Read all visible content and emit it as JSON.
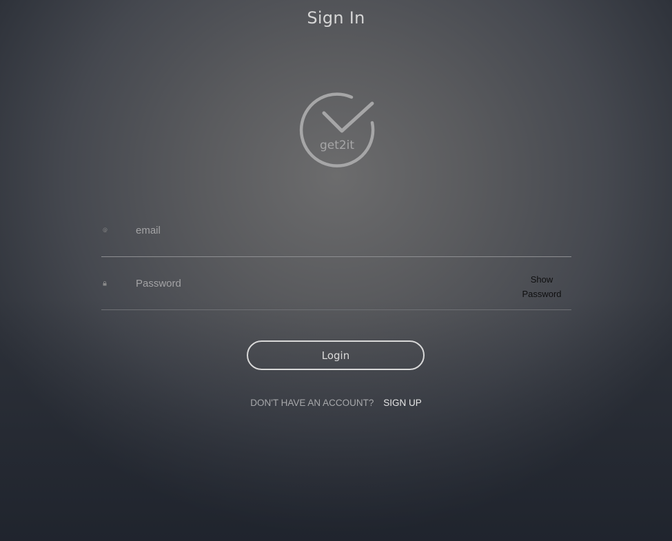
{
  "page": {
    "title": "Sign In"
  },
  "logo": {
    "text": "get2it",
    "icon": "checkmark-circle-icon",
    "color": "#a9a9aa"
  },
  "form": {
    "email": {
      "placeholder": "email",
      "value": "",
      "icon": "at-sign-icon"
    },
    "password": {
      "placeholder": "Password",
      "value": "",
      "icon": "lock-icon",
      "toggle_line1": "Show",
      "toggle_line2": "Password"
    },
    "login_label": "Login"
  },
  "signup": {
    "prompt": "DON'T HAVE AN ACCOUNT?",
    "link_label": "SIGN UP"
  }
}
